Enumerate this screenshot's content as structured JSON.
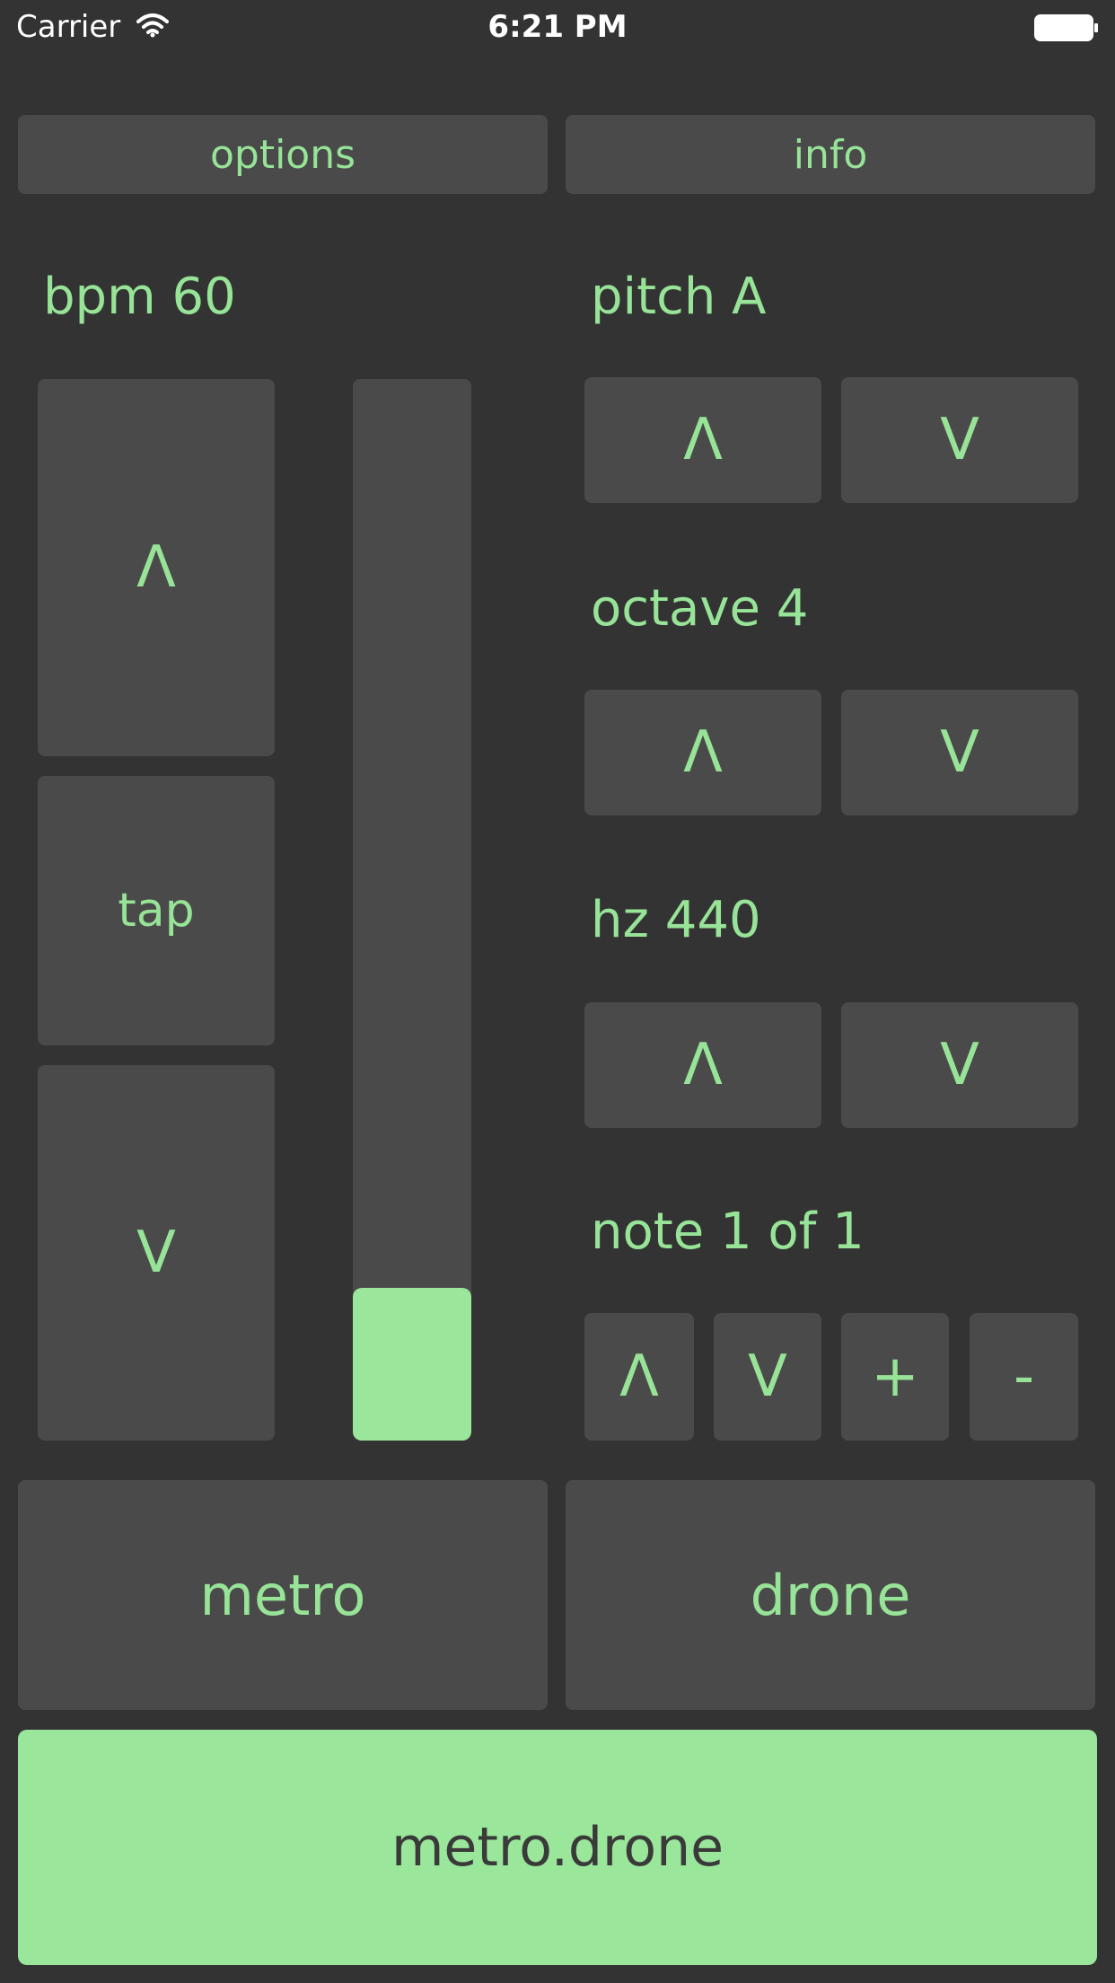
{
  "status_bar": {
    "carrier": "Carrier",
    "time": "6:21 PM",
    "wifi_icon": "wifi-icon",
    "battery_icon": "battery-icon"
  },
  "top_buttons": {
    "options": "options",
    "info": "info"
  },
  "bpm": {
    "label": "bpm 60",
    "up": "Λ",
    "tap": "tap",
    "down": "V",
    "slider_fraction": 0.0
  },
  "pitch": {
    "label": "pitch A",
    "up": "Λ",
    "down": "V"
  },
  "octave": {
    "label": "octave 4",
    "up": "Λ",
    "down": "V"
  },
  "hz": {
    "label": "hz 440",
    "up": "Λ",
    "down": "V"
  },
  "note": {
    "label": "note 1 of 1",
    "up": "Λ",
    "down": "V",
    "add": "+",
    "remove": "-"
  },
  "modes": {
    "metro": "metro",
    "drone": "drone"
  },
  "main_button": "metro.drone",
  "colors": {
    "background": "#333333",
    "button": "#4a4a4a",
    "accent": "#9ae69a",
    "text_accent": "#97e397",
    "main_text": "#3a3a3a"
  }
}
